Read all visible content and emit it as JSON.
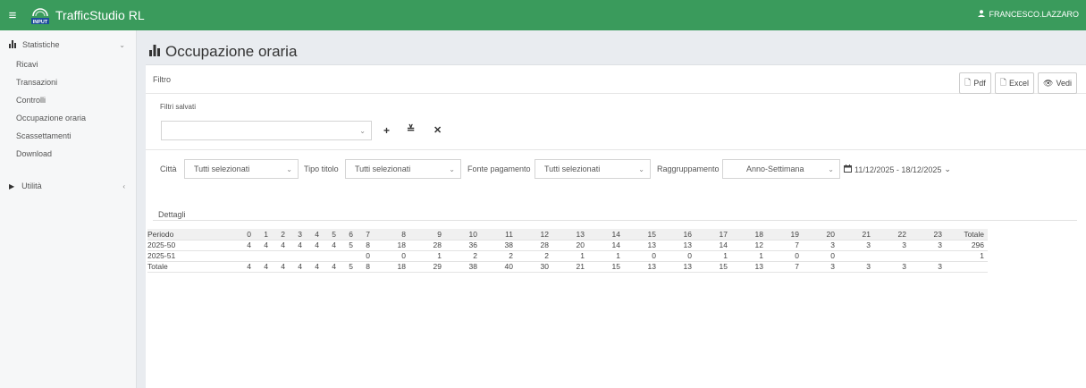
{
  "header": {
    "app_title": "TrafficStudio RL",
    "logo_text": "INPUT",
    "user_name": "FRANCESCO.LAZZARO"
  },
  "sidebar": {
    "sections": [
      {
        "label": "Statistiche",
        "expanded": true,
        "items": [
          "Ricavi",
          "Transazioni",
          "Controlli",
          "Occupazione oraria",
          "Scassettamenti",
          "Download"
        ]
      },
      {
        "label": "Utilità",
        "expanded": false
      }
    ]
  },
  "page": {
    "title": "Occupazione oraria",
    "filter_label": "Filtro",
    "export": {
      "pdf": "Pdf",
      "excel": "Excel",
      "view": "Vedi"
    },
    "saved_filters": {
      "label": "Filtri salvati",
      "value": ""
    },
    "filters": {
      "citta": {
        "label": "Città",
        "value": "Tutti selezionati"
      },
      "tipo_titolo": {
        "label": "Tipo titolo",
        "value": "Tutti selezionati"
      },
      "fonte_pagamento": {
        "label": "Fonte pagamento",
        "value": "Tutti selezionati"
      },
      "raggruppamento": {
        "label": "Raggruppamento",
        "value": "Anno-Settimana"
      },
      "date_range": "11/12/2025 - 18/12/2025"
    },
    "details_tab": "Dettagli"
  },
  "table": {
    "columns": [
      "Periodo",
      "0",
      "1",
      "2",
      "3",
      "4",
      "5",
      "6",
      "7",
      "8",
      "9",
      "10",
      "11",
      "12",
      "13",
      "14",
      "15",
      "16",
      "17",
      "18",
      "19",
      "20",
      "21",
      "22",
      "23",
      "Totale"
    ],
    "rows": [
      [
        "2025-50",
        "4",
        "4",
        "4",
        "4",
        "4",
        "4",
        "5",
        "8",
        "18",
        "28",
        "36",
        "38",
        "28",
        "20",
        "14",
        "13",
        "13",
        "14",
        "12",
        "7",
        "3",
        "3",
        "3",
        "3",
        "296"
      ],
      [
        "2025-51",
        "",
        "",
        "",
        "",
        "",
        "",
        "",
        "0",
        "0",
        "1",
        "2",
        "2",
        "2",
        "1",
        "1",
        "0",
        "0",
        "1",
        "1",
        "0",
        "0",
        "",
        "",
        "",
        "1"
      ],
      [
        "Totale",
        "4",
        "4",
        "4",
        "4",
        "4",
        "4",
        "5",
        "8",
        "18",
        "29",
        "38",
        "40",
        "30",
        "21",
        "15",
        "13",
        "13",
        "15",
        "13",
        "7",
        "3",
        "3",
        "3",
        "3",
        ""
      ]
    ]
  },
  "colors": {
    "topbar": "#3a9b5c",
    "background": "#e9ecf0"
  }
}
